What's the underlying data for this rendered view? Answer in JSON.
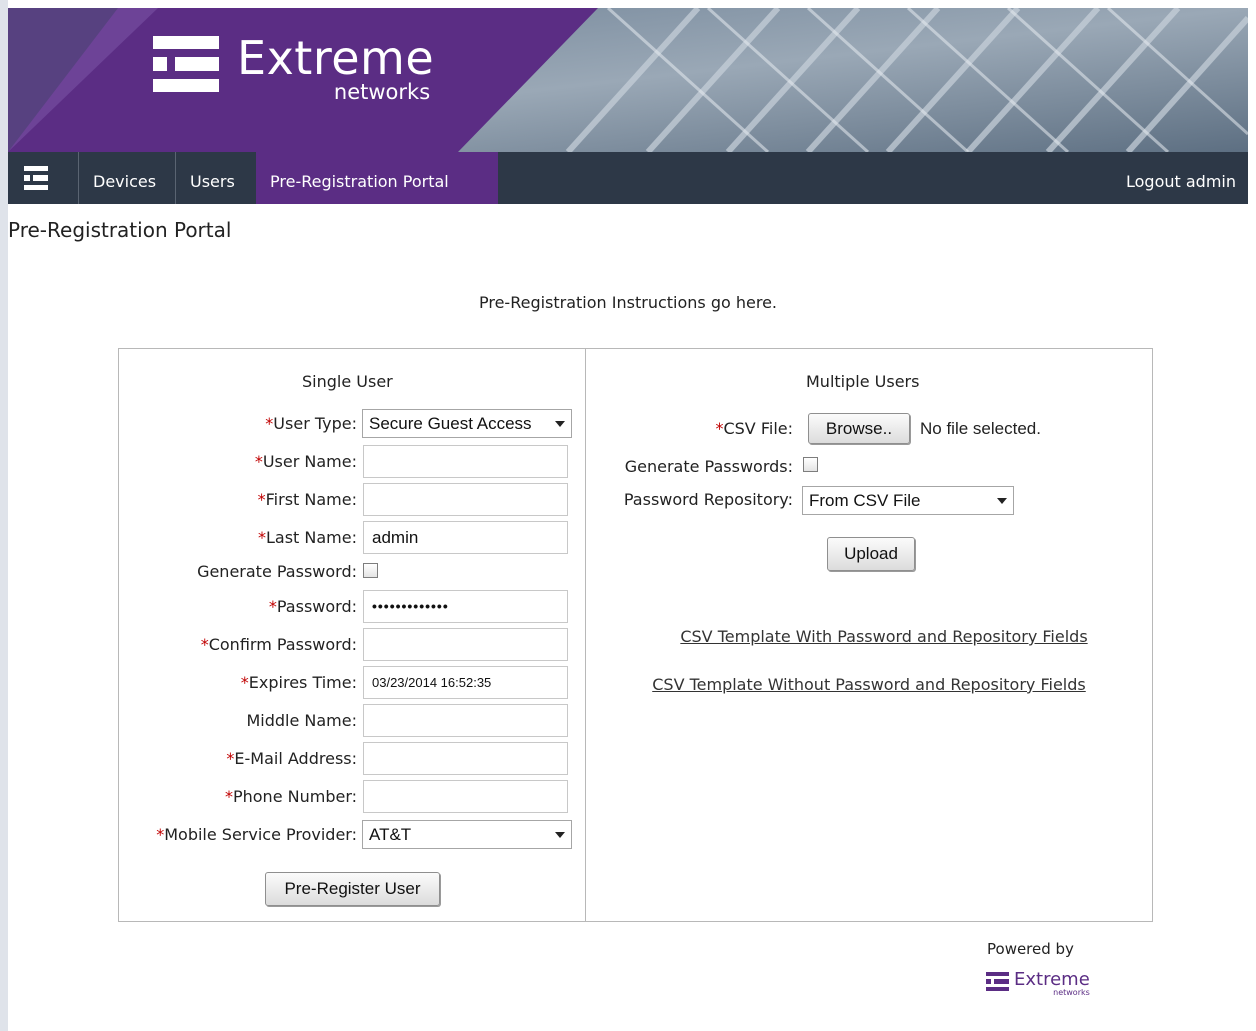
{
  "brand": {
    "name": "Extreme",
    "sub": "networks",
    "colors": {
      "purple": "#5b2d84",
      "nav_bg": "#2d3847",
      "required": "#c00000"
    }
  },
  "nav": {
    "home_icon": "extreme-logo-icon",
    "items": [
      {
        "label": "Devices"
      },
      {
        "label": "Users"
      },
      {
        "label": "Pre-Registration Portal",
        "active": true
      }
    ],
    "logout": "Logout admin"
  },
  "page": {
    "title": "Pre-Registration Portal",
    "instructions": "Pre-Registration Instructions go here."
  },
  "single_user": {
    "title": "Single User",
    "user_type": {
      "label": "User Type:",
      "value": "Secure Guest Access"
    },
    "user_name": {
      "label": "User Name:",
      "value": ""
    },
    "first_name": {
      "label": "First Name:",
      "value": ""
    },
    "last_name": {
      "label": "Last Name:",
      "value": "admin"
    },
    "generate_password": {
      "label": "Generate Password:",
      "checked": false
    },
    "password": {
      "label": "Password:",
      "value": "•••••••••••••"
    },
    "confirm_password": {
      "label": "Confirm Password:",
      "value": ""
    },
    "expires_time": {
      "label": "Expires Time:",
      "value": "03/23/2014 16:52:35"
    },
    "middle_name": {
      "label": "Middle Name:",
      "value": ""
    },
    "email": {
      "label": "E-Mail Address:",
      "value": ""
    },
    "phone": {
      "label": "Phone Number:",
      "value": ""
    },
    "mobile_provider": {
      "label": "Mobile Service Provider:",
      "value": "AT&T"
    },
    "submit": "Pre-Register User"
  },
  "multiple_users": {
    "title": "Multiple Users",
    "csv_file": {
      "label": "CSV File:",
      "browse": "Browse..",
      "status": "No file selected."
    },
    "generate_passwords": {
      "label": "Generate Passwords:",
      "checked": false
    },
    "password_repository": {
      "label": "Password Repository:",
      "value": "From CSV File"
    },
    "upload": "Upload",
    "link_with": "CSV Template With Password and Repository Fields",
    "link_without": "CSV Template Without Password and Repository Fields"
  },
  "footer": {
    "powered_by": "Powered by",
    "logo_name": "Extreme",
    "logo_sub": "networks"
  },
  "required_marker": "*"
}
